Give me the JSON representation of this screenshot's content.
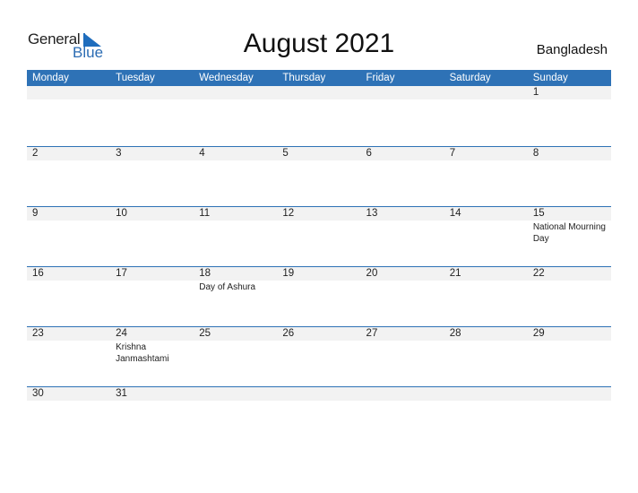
{
  "logo": {
    "general": "General",
    "blue": "Blue"
  },
  "title": "August 2021",
  "country": "Bangladesh",
  "colors": {
    "header": "#2e72b6",
    "strip": "#f2f2f2",
    "logo_blue": "#1f6dbd"
  },
  "weekdays": [
    "Monday",
    "Tuesday",
    "Wednesday",
    "Thursday",
    "Friday",
    "Saturday",
    "Sunday"
  ],
  "weeks": [
    [
      {
        "d": ""
      },
      {
        "d": ""
      },
      {
        "d": ""
      },
      {
        "d": ""
      },
      {
        "d": ""
      },
      {
        "d": ""
      },
      {
        "d": "1"
      }
    ],
    [
      {
        "d": "2"
      },
      {
        "d": "3"
      },
      {
        "d": "4"
      },
      {
        "d": "5"
      },
      {
        "d": "6"
      },
      {
        "d": "7"
      },
      {
        "d": "8"
      }
    ],
    [
      {
        "d": "9"
      },
      {
        "d": "10"
      },
      {
        "d": "11"
      },
      {
        "d": "12"
      },
      {
        "d": "13"
      },
      {
        "d": "14"
      },
      {
        "d": "15",
        "h": "National Mourning Day"
      }
    ],
    [
      {
        "d": "16"
      },
      {
        "d": "17"
      },
      {
        "d": "18",
        "h": "Day of Ashura"
      },
      {
        "d": "19"
      },
      {
        "d": "20"
      },
      {
        "d": "21"
      },
      {
        "d": "22"
      }
    ],
    [
      {
        "d": "23"
      },
      {
        "d": "24",
        "h": "Krishna Janmashtami"
      },
      {
        "d": "25"
      },
      {
        "d": "26"
      },
      {
        "d": "27"
      },
      {
        "d": "28"
      },
      {
        "d": "29"
      }
    ],
    [
      {
        "d": "30"
      },
      {
        "d": "31"
      },
      {
        "d": ""
      },
      {
        "d": ""
      },
      {
        "d": ""
      },
      {
        "d": ""
      },
      {
        "d": ""
      }
    ]
  ]
}
